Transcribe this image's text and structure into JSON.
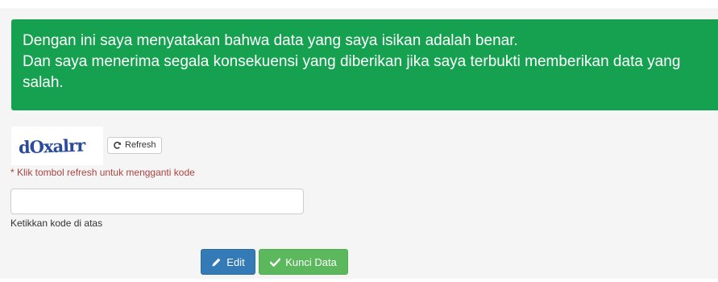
{
  "statement": {
    "line1": "Dengan ini saya menyatakan bahwa data yang saya isikan adalah benar.",
    "line2": "Dan saya menerima segala konsekuensi yang diberikan jika saya terbukti memberikan data yang",
    "line3": "salah."
  },
  "captcha": {
    "image_text": "dOxalrr",
    "refresh_label": "Refresh",
    "refresh_icon": "refresh-icon",
    "hint": "* Klik tombol refresh untuk mengganti kode"
  },
  "code_field": {
    "value": "",
    "placeholder": "",
    "label": "Ketikkan kode di atas"
  },
  "actions": {
    "edit_label": "Edit",
    "edit_icon": "pencil-icon",
    "lock_label": "Kunci Data",
    "lock_icon": "checkmark-icon"
  },
  "colors": {
    "alert_bg": "#16a150",
    "edit_btn": "#337ab7",
    "lock_btn": "#5cb85c",
    "hint_text": "#a94442",
    "captcha_text": "#2a4a9a"
  }
}
